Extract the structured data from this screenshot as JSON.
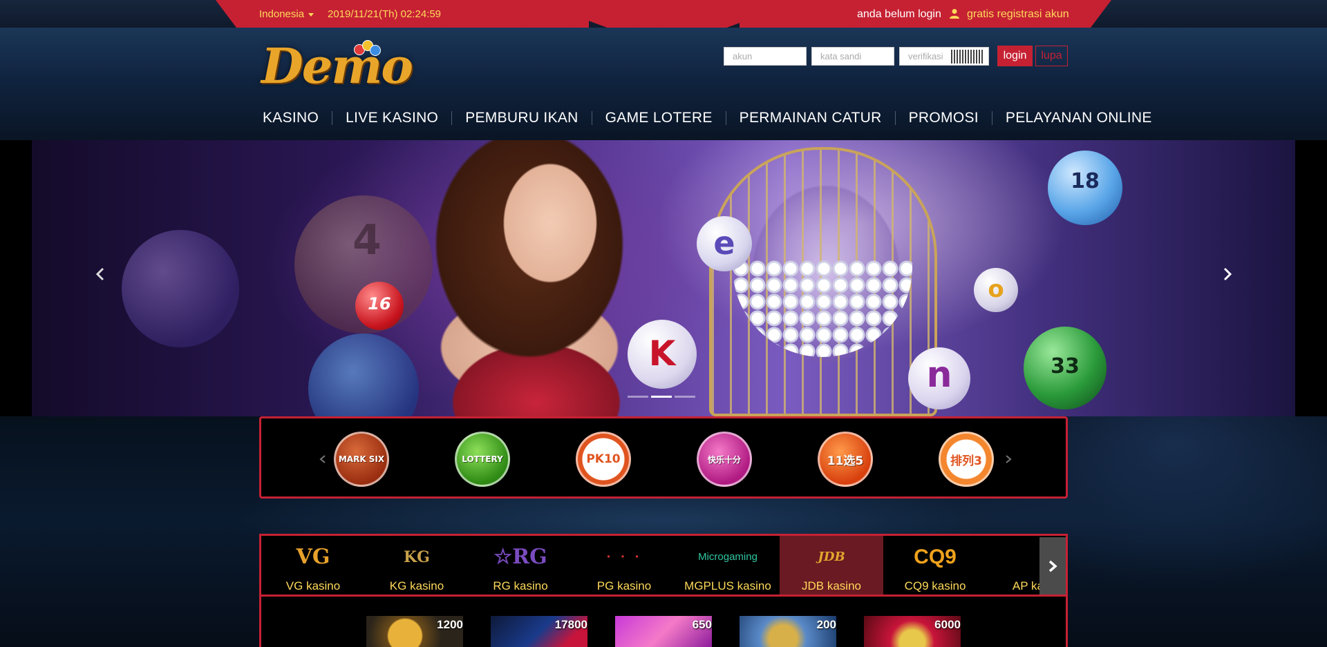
{
  "topbar": {
    "language": "Indonesia",
    "datetime": "2019/11/21(Th) 02:24:59",
    "login_status": "anda belum login",
    "register_link": "gratis registrasi akun",
    "user_icon": "user-icon"
  },
  "header": {
    "logo_text": "Demo",
    "account_placeholder": "akun",
    "password_placeholder": "kata sandi",
    "verify_placeholder": "verifikasi",
    "login_button": "login",
    "forgot_button": "lupa"
  },
  "nav": {
    "items": [
      "KASINO",
      "LIVE KASINO",
      "PEMBURU IKAN",
      "GAME LOTERE",
      "PERMAINAN CATUR",
      "PROMOSI",
      "PELAYANAN ONLINE"
    ]
  },
  "banner": {
    "prev_icon": "chevron-left-icon",
    "next_icon": "chevron-right-icon",
    "ball_labels": [
      "16",
      "e",
      "K",
      "o",
      "n",
      "18",
      "33",
      "4"
    ],
    "slide_count": 3,
    "active_slide": 2
  },
  "lottery": {
    "items": [
      "MARK SIX",
      "LOTTERY",
      "PK10",
      "快乐十分",
      "11选5",
      "排列3"
    ],
    "colors": [
      "#b8451c",
      "#3e9a1e",
      "#e0541f",
      "#c8288f",
      "#e1521a",
      "#f0782a"
    ]
  },
  "casino": {
    "tabs": [
      {
        "logo": "VG",
        "label": "VG kasino",
        "color": "#e7a12b"
      },
      {
        "logo": "KG",
        "label": "KG kasino",
        "color": "#c9a14a"
      },
      {
        "logo": "☆RG",
        "label": "RG kasino",
        "color": "#7a4bbf"
      },
      {
        "logo": "· · ·",
        "label": "PG kasino",
        "color": "#d33"
      },
      {
        "logo": "Microgaming",
        "label": "MGPLUS kasino",
        "color": "#2fc6a0"
      },
      {
        "logo": "JDB",
        "label": "JDB kasino",
        "color": "#e2a52c"
      },
      {
        "logo": "CQ9",
        "label": "CQ9 kasino",
        "color": "#f0a21c"
      },
      {
        "logo": "",
        "label": "AP kasino",
        "color": "#e7a12b"
      }
    ],
    "active_tab": 5,
    "games": [
      {
        "jackpot": "1200"
      },
      {
        "jackpot": "17800"
      },
      {
        "jackpot": "650"
      },
      {
        "jackpot": "200"
      },
      {
        "jackpot": "6000"
      }
    ]
  }
}
